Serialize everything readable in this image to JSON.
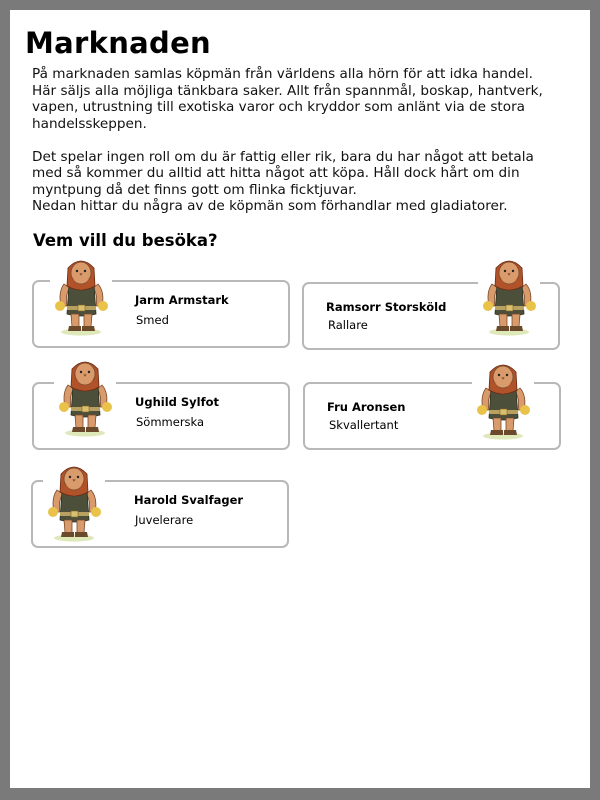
{
  "page": {
    "title": "Marknaden",
    "intro": "På marknaden samlas köpmän från världens alla hörn för att idka handel.\nHär säljs alla möjliga tänkbara saker. Allt från spannmål, boskap, hantverk,\nvapen, utrustning till exotiska varor och kryddor som anlänt via de stora\nhandelsskeppen.\n\nDet spelar ingen roll om du är fattig eller rik, bara du har något att betala\nmed så kommer du alltid att hitta något att köpa. Håll dock hårt om din\nmyntpung då det finns gott om flinka ficktjuvar.\nNedan hittar du några av de köpmän som förhandlar med gladiatorer.",
    "subtitle": "Vem vill du besöka?"
  },
  "merchants": [
    {
      "name": "Jarm Armstark",
      "role": "Smed",
      "icon": "warrior-portrait-icon"
    },
    {
      "name": "Ramsorr Storsköld",
      "role": "Rallare",
      "icon": "warrior-portrait-icon"
    },
    {
      "name": "Ughild Sylfot",
      "role": "Sömmerska",
      "icon": "warrior-portrait-icon"
    },
    {
      "name": "Fru Aronsen",
      "role": "Skvallertant",
      "icon": "warrior-portrait-icon"
    },
    {
      "name": "Harold Svalfager",
      "role": "Juvelerare",
      "icon": "warrior-portrait-icon"
    }
  ],
  "colors": {
    "frame": "#7a7a7a",
    "card_border": "#b8b8b8",
    "hair": "#b0522a",
    "skin": "#d99a6c"
  }
}
